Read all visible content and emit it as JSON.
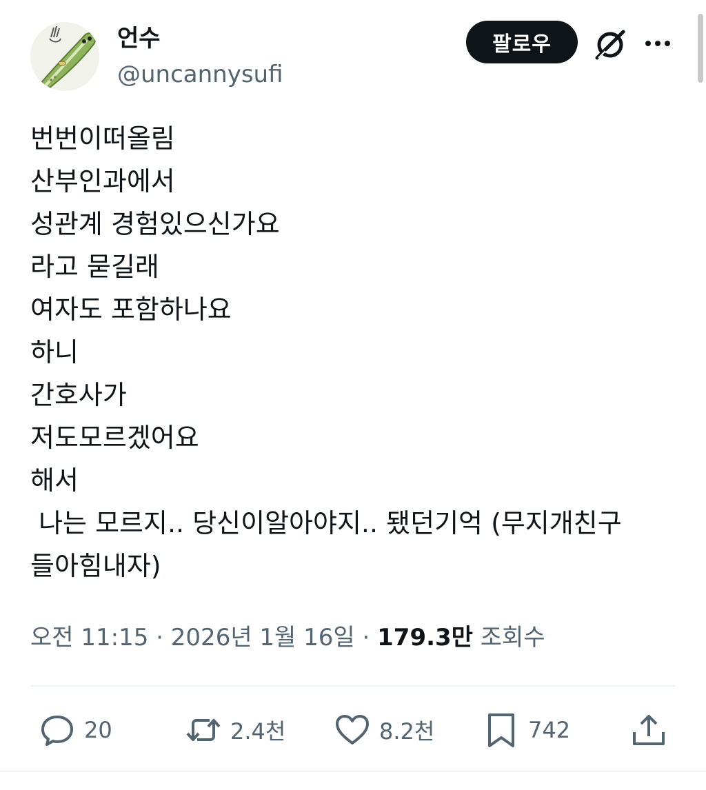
{
  "author": {
    "display_name": "언수",
    "handle": "@uncannysufi"
  },
  "header": {
    "follow_label": "팔로우",
    "grok_icon": "grok-slash-icon",
    "more_icon": "more-dots-icon"
  },
  "tweet": {
    "lines": [
      "번번이떠올림",
      "산부인과에서",
      "성관계 경험있으신가요",
      "라고 묻길래",
      "여자도 포함하나요",
      "하니",
      "간호사가",
      "저도모르겠어요",
      "해서",
      " 나는 모르지.. 당신이알아야지.. 됐던기억 (무지개친구",
      "들아힘내자)"
    ]
  },
  "meta": {
    "time": "오전 11:15",
    "sep1": " · ",
    "date": "2026년 1월 16일",
    "sep2": " · ",
    "views_count": "179.3만",
    "views_label": " 조회수"
  },
  "actions": {
    "reply": {
      "icon": "reply-bubble-icon",
      "count": "20"
    },
    "retweet": {
      "icon": "retweet-icon",
      "count": "2.4천"
    },
    "like": {
      "icon": "heart-icon",
      "count": "8.2천"
    },
    "bookmark": {
      "icon": "bookmark-icon",
      "count": "742"
    },
    "share": {
      "icon": "share-upload-icon"
    }
  },
  "colors": {
    "text": "#0f1419",
    "secondary": "#536471",
    "follow_bg": "#0f1419",
    "divider": "#eff3f4"
  }
}
